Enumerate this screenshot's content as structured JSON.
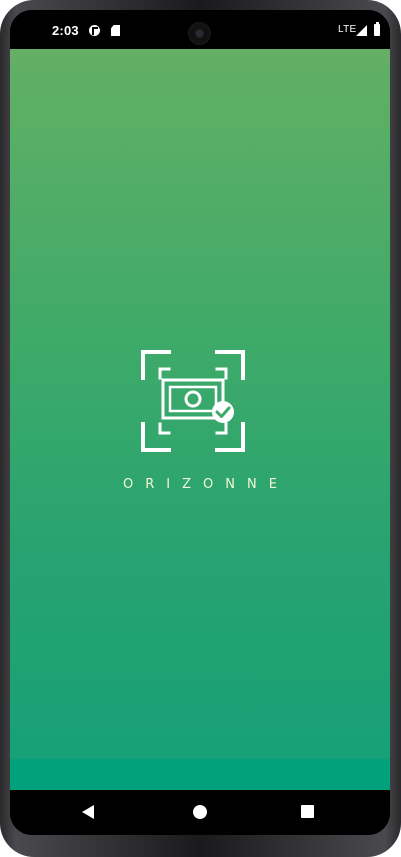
{
  "status_bar": {
    "time": "2:03",
    "network": "LTE",
    "icons": [
      "f-notification-icon",
      "sd-card-icon",
      "camera-cutout",
      "signal-icon",
      "battery-icon"
    ]
  },
  "splash": {
    "brand_name": "ORIZONNE",
    "logo_icon": "money-scan-check-icon",
    "colors": {
      "gradient_top": "#63af65",
      "gradient_bottom": "#15a077",
      "bottom_band": "#03a17b",
      "brand_text": "#f4f7d6"
    }
  },
  "navigation_bar": {
    "buttons": [
      "back",
      "home",
      "recents"
    ]
  }
}
